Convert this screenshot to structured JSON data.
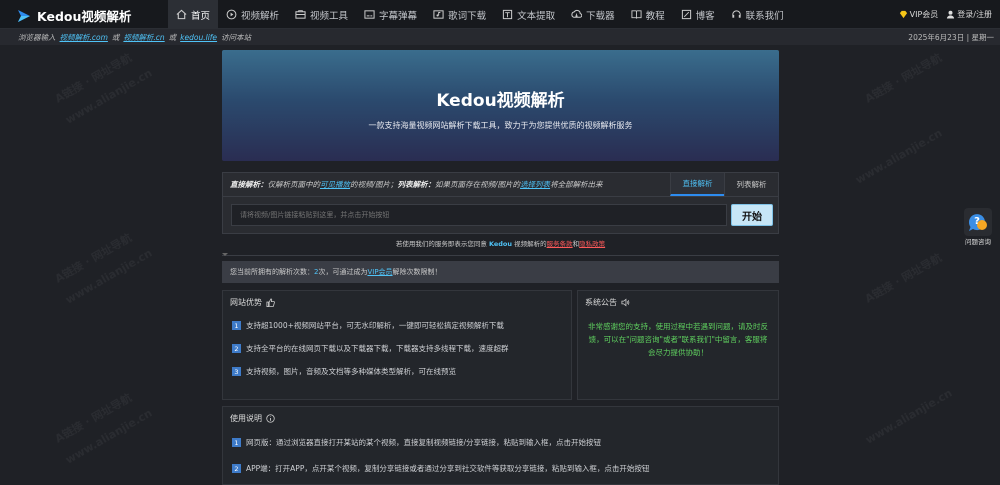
{
  "nav": {
    "logo_text": "Kedou视频解析",
    "items": [
      {
        "label": "首页",
        "icon": "home-icon"
      },
      {
        "label": "视频解析",
        "icon": "video-icon"
      },
      {
        "label": "视频工具",
        "icon": "toolbox-icon"
      },
      {
        "label": "字幕弹幕",
        "icon": "subtitle-icon"
      },
      {
        "label": "歌词下载",
        "icon": "lyrics-icon"
      },
      {
        "label": "文本提取",
        "icon": "text-icon"
      },
      {
        "label": "下载器",
        "icon": "download-icon"
      },
      {
        "label": "教程",
        "icon": "book-icon"
      },
      {
        "label": "博客",
        "icon": "blog-icon"
      },
      {
        "label": "联系我们",
        "icon": "headset-icon"
      }
    ],
    "vip_label": "VIP会员",
    "login_label": "登录/注册"
  },
  "subbar": {
    "prefix": "浏览器输入",
    "link1": "视频解析.com",
    "or1": "或",
    "link2": "视频解析.cn",
    "or2": "或",
    "link3": "kedou.life",
    "suffix": "访问本站",
    "date": "2025年6月23日 | 星期一"
  },
  "hero": {
    "title": "Kedou视频解析",
    "subtitle": "一款支持海量视频网站解析下载工具，致力于为您提供优质的视频解析服务"
  },
  "parse_panel": {
    "direct_label": "直接解析：",
    "direct_text_1": "仅解析页面中的",
    "direct_highlight": "可见播放",
    "direct_text_2": "的视频/图片；",
    "list_label": "列表解析：",
    "list_text_1": "如果页面存在视频/图片的",
    "list_highlight": "选择列表",
    "list_text_2": "将全部解析出来",
    "tab_direct": "直接解析",
    "tab_list": "列表解析",
    "input_placeholder": "请将视频/图片链接粘贴到这里，并点击开始按钮",
    "start_button": "开始"
  },
  "notice": {
    "text_1": "若使用我们的服务即表示您同意",
    "brand": "Kedou",
    "text_2": "视频解析的",
    "terms": "服务条款",
    "and": "和",
    "privacy": "隐私政策"
  },
  "count_bar": {
    "text_1": "您当前所拥有的解析次数：",
    "count": "2",
    "text_2": "次，可通过成为",
    "vip": "VIP会员",
    "text_3": "解除次数限制！"
  },
  "advantages": {
    "title": "网站优势",
    "items": [
      "支持超1000+视频网站平台，可无水印解析，一键即可轻松搞定视频解析下载",
      "支持全平台的在线网页下载以及下载器下载，下载器支持多线程下载，速度超群",
      "支持视频，图片，音频及文档等多种媒体类型解析，可在线预览"
    ]
  },
  "announcement": {
    "title": "系统公告",
    "text": "非常感谢您的支持，使用过程中若遇到问题，请及时反馈，可以在\"问题咨询\"或者\"联系我们\"中留言，客服将会尽力提供协助！",
    "color": "#5fd05f"
  },
  "usage": {
    "title": "使用说明",
    "items": [
      "网页版：通过浏览器直接打开某站的某个视频，直接复制视频链接/分享链接，粘贴到输入框，点击开始按钮",
      "APP端：打开APP，点开某个视频，复制分享链接或者通过分享到社交软件等获取分享链接，粘贴到输入框，点击开始按钮"
    ]
  },
  "help": {
    "label": "问题咨询"
  },
  "watermark": {
    "text": "A链接 · 网址导航",
    "url": "www.alianjie.cn"
  },
  "colors": {
    "accent": "#4fc3f7",
    "bg": "#1f2126",
    "nav_bg": "#17191d"
  }
}
